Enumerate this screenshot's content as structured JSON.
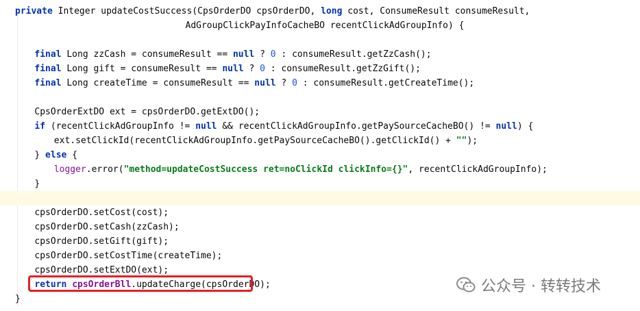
{
  "editor": {
    "lines": [
      {
        "tokens": [
          {
            "t": "kw",
            "v": "private"
          },
          {
            "t": "p",
            "v": " Integer updateCostSuccess(CpsOrderDO cpsOrderDO, "
          },
          {
            "t": "kw",
            "v": "long"
          },
          {
            "t": "p",
            "v": " cost, ConsumeResult consumeResult,"
          }
        ],
        "indent": 0
      },
      {
        "tokens": [
          {
            "t": "p",
            "v": "AdGroupClickPayInfoCacheBO recentClickAdGroupInfo) {"
          }
        ],
        "indent": 35
      },
      {
        "tokens": [],
        "indent": 0
      },
      {
        "tokens": [
          {
            "t": "kw",
            "v": "final"
          },
          {
            "t": "p",
            "v": " Long zzCash = consumeResult == "
          },
          {
            "t": "kw",
            "v": "null"
          },
          {
            "t": "p",
            "v": " ? "
          },
          {
            "t": "num",
            "v": "0"
          },
          {
            "t": "p",
            "v": " : consumeResult.getZzCash();"
          }
        ],
        "indent": 4
      },
      {
        "tokens": [
          {
            "t": "kw",
            "v": "final"
          },
          {
            "t": "p",
            "v": " Long gift = consumeResult == "
          },
          {
            "t": "kw",
            "v": "null"
          },
          {
            "t": "p",
            "v": " ? "
          },
          {
            "t": "num",
            "v": "0"
          },
          {
            "t": "p",
            "v": " : consumeResult.getZzGift();"
          }
        ],
        "indent": 4
      },
      {
        "tokens": [
          {
            "t": "kw",
            "v": "final"
          },
          {
            "t": "p",
            "v": " Long createTime = consumeResult == "
          },
          {
            "t": "kw",
            "v": "null"
          },
          {
            "t": "p",
            "v": " ? "
          },
          {
            "t": "num",
            "v": "0"
          },
          {
            "t": "p",
            "v": " : consumeResult.getCreateTime();"
          }
        ],
        "indent": 4
      },
      {
        "tokens": [],
        "indent": 0
      },
      {
        "tokens": [
          {
            "t": "p",
            "v": "CpsOrderExtDO ext = cpsOrderDO.getExtDO();"
          }
        ],
        "indent": 4
      },
      {
        "tokens": [
          {
            "t": "kw",
            "v": "if"
          },
          {
            "t": "p",
            "v": " (recentClickAdGroupInfo != "
          },
          {
            "t": "kw",
            "v": "null"
          },
          {
            "t": "p",
            "v": " && recentClickAdGroupInfo.getPaySourceCacheBO() != "
          },
          {
            "t": "kw",
            "v": "null"
          },
          {
            "t": "p",
            "v": ") {"
          }
        ],
        "indent": 4
      },
      {
        "tokens": [
          {
            "t": "p",
            "v": "ext.setClickId(recentClickAdGroupInfo.getPaySourceCacheBO().getClickId() + "
          },
          {
            "t": "str",
            "v": "\"\""
          },
          {
            "t": "p",
            "v": ");"
          }
        ],
        "indent": 8
      },
      {
        "tokens": [
          {
            "t": "p",
            "v": "} "
          },
          {
            "t": "kw",
            "v": "else"
          },
          {
            "t": "p",
            "v": " {"
          }
        ],
        "indent": 4
      },
      {
        "tokens": [
          {
            "t": "fld",
            "v": "logger"
          },
          {
            "t": "p",
            "v": ".error("
          },
          {
            "t": "str",
            "v": "\"method=updateCostSuccess ret=noClickId clickInfo={}\""
          },
          {
            "t": "p",
            "v": ", recentClickAdGroupInfo);"
          }
        ],
        "indent": 8
      },
      {
        "tokens": [
          {
            "t": "p",
            "v": "}"
          }
        ],
        "indent": 4
      },
      {
        "tokens": [],
        "indent": 0,
        "current": true
      },
      {
        "tokens": [
          {
            "t": "p",
            "v": "cpsOrderDO.setCost(cost);"
          }
        ],
        "indent": 4
      },
      {
        "tokens": [
          {
            "t": "p",
            "v": "cpsOrderDO.setCash(zzCash);"
          }
        ],
        "indent": 4
      },
      {
        "tokens": [
          {
            "t": "p",
            "v": "cpsOrderDO.setGift(gift);"
          }
        ],
        "indent": 4
      },
      {
        "tokens": [
          {
            "t": "p",
            "v": "cpsOrderDO.setCostTime(createTime);"
          }
        ],
        "indent": 4
      },
      {
        "tokens": [
          {
            "t": "p",
            "v": "cpsOrderDO.setExtDO(ext);"
          }
        ],
        "indent": 4
      },
      {
        "tokens": [
          {
            "t": "kw",
            "v": "return"
          },
          {
            "t": "p",
            "v": " "
          },
          {
            "t": "fldb",
            "v": "cpsOrderBll"
          },
          {
            "t": "p",
            "v": ".updateCharge(cpsOrderDO);"
          }
        ],
        "indent": 4
      },
      {
        "tokens": [
          {
            "t": "p",
            "v": "}"
          }
        ],
        "indent": 0
      }
    ]
  },
  "watermark": {
    "text": "公众号 · 转转技术",
    "icon": "wechat-icon"
  },
  "colors": {
    "keyword": "#0033b3",
    "string": "#067d17",
    "number": "#1750eb",
    "field": "#871094",
    "highlight_box": "#ec1c24",
    "current_line": "#fffae3"
  }
}
